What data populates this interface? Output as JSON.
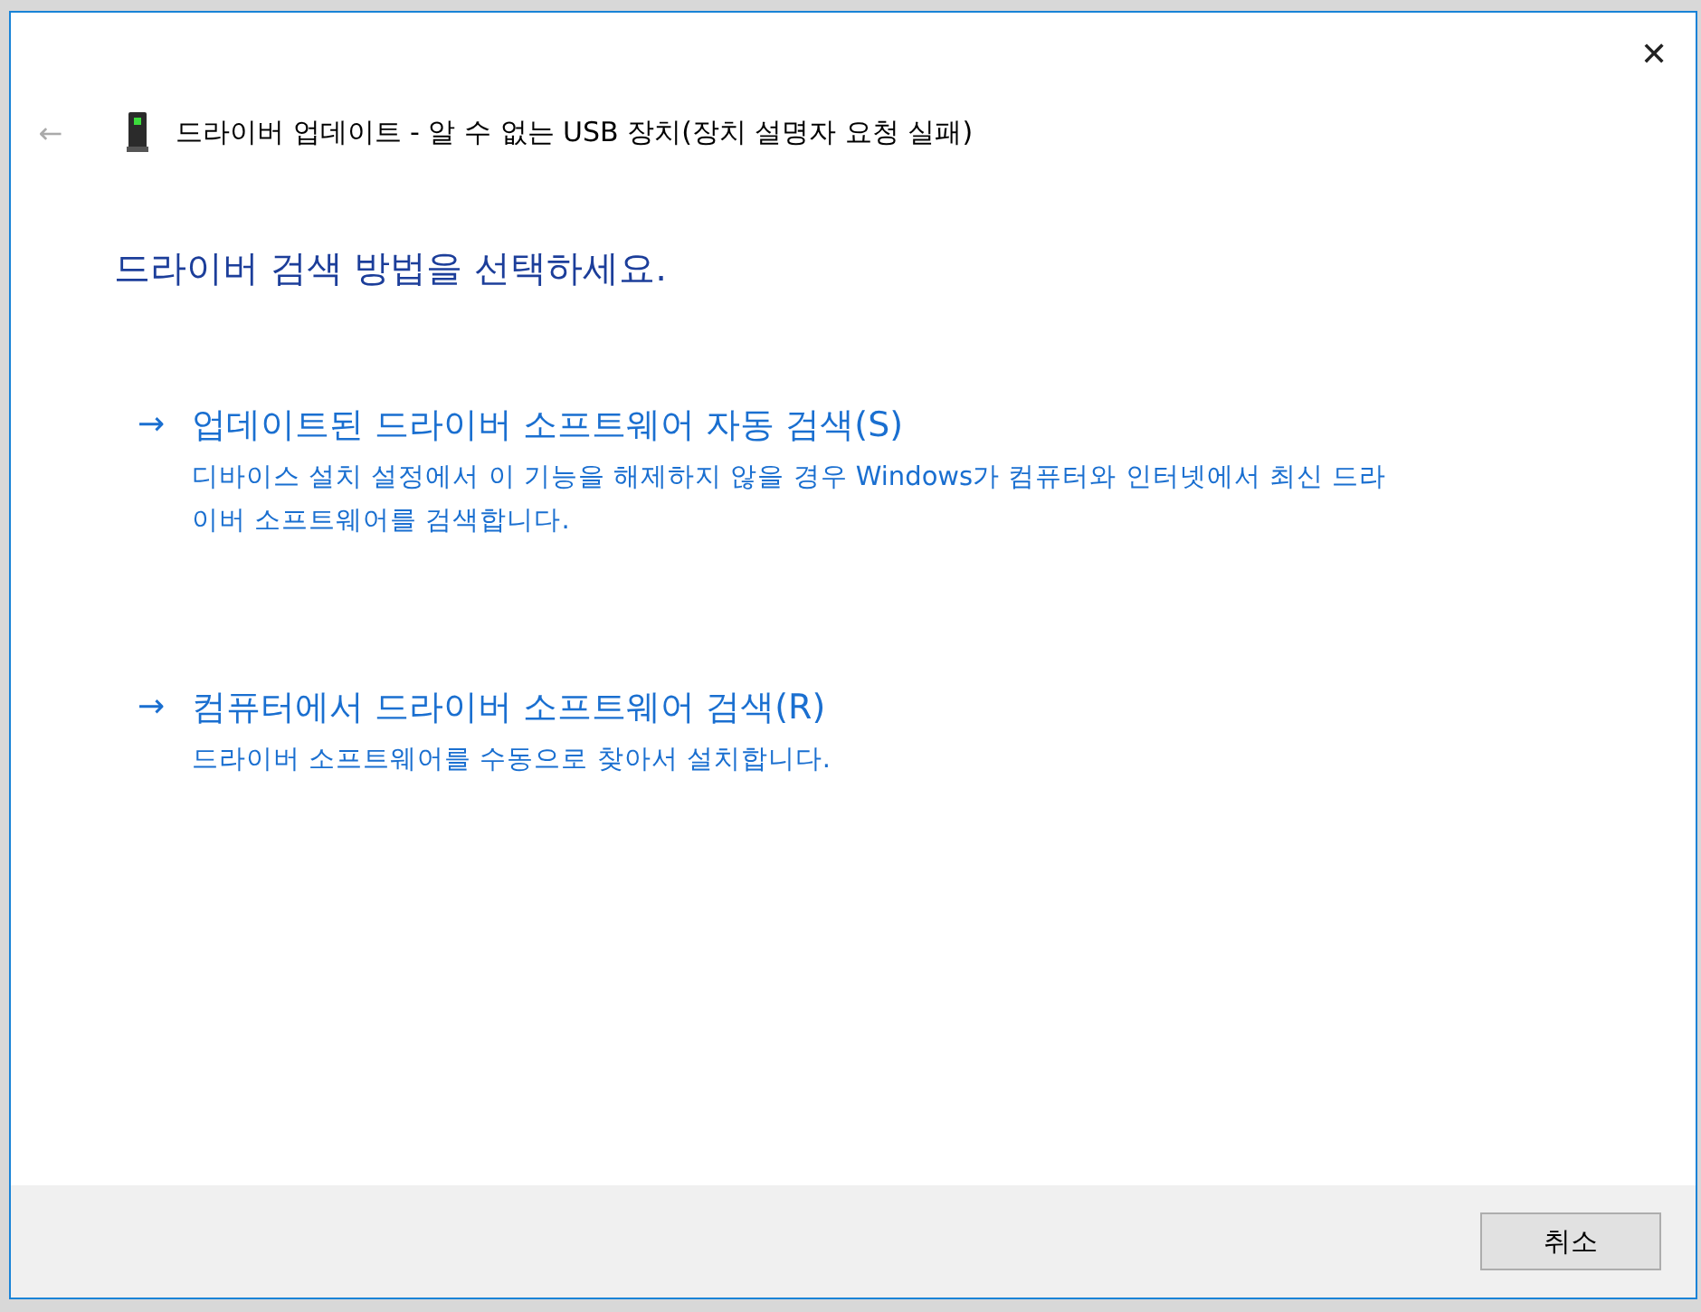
{
  "window": {
    "title": "드라이버 업데이트 - 알 수 없는 USB 장치(장치 설명자 요청 실패)",
    "close": "✕",
    "back": "←"
  },
  "heading": "드라이버 검색 방법을 선택하세요.",
  "options": [
    {
      "arrow": "→",
      "title": "업데이트된 드라이버 소프트웨어 자동 검색(S)",
      "description": "디바이스 설치 설정에서 이 기능을 해제하지 않을 경우 Windows가 컴퓨터와 인터넷에서 최신 드라이버 소프트웨어를 검색합니다."
    },
    {
      "arrow": "→",
      "title": "컴퓨터에서 드라이버 소프트웨어 검색(R)",
      "description": "드라이버 소프트웨어를 수동으로 찾아서 설치합니다."
    }
  ],
  "buttons": [
    "취소"
  ]
}
